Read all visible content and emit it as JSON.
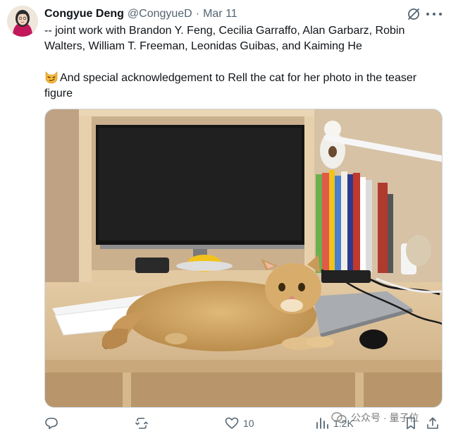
{
  "tweet": {
    "author_name": "Congyue Deng",
    "author_handle": "@CongyueD",
    "separator": "·",
    "date": "Mar 11",
    "line1": "-- joint work with Brandon Y. Feng, Cecilia Garraffo, Alan Garbarz, Robin Walters, William T. Freeman, Leonidas Guibas, and Kaiming He",
    "line2": "And special acknowledgement to Rell the cat for her photo in the teaser figure",
    "emoji_icon": "smirking-cat-emoji"
  },
  "actions": {
    "reply_count": "",
    "retweet_count": "",
    "like_count": "10",
    "views_count": "1.2K"
  },
  "watermark": {
    "text": "公众号 · 量子位"
  },
  "icons": {
    "grok": "grok-icon",
    "more": "more-icon",
    "reply": "reply-icon",
    "retweet": "retweet-icon",
    "like": "heart-icon",
    "views": "views-icon",
    "bookmark": "bookmark-icon",
    "share": "share-icon"
  },
  "colors": {
    "text": "#0f1419",
    "muted": "#536471",
    "border": "#cfd9de"
  }
}
